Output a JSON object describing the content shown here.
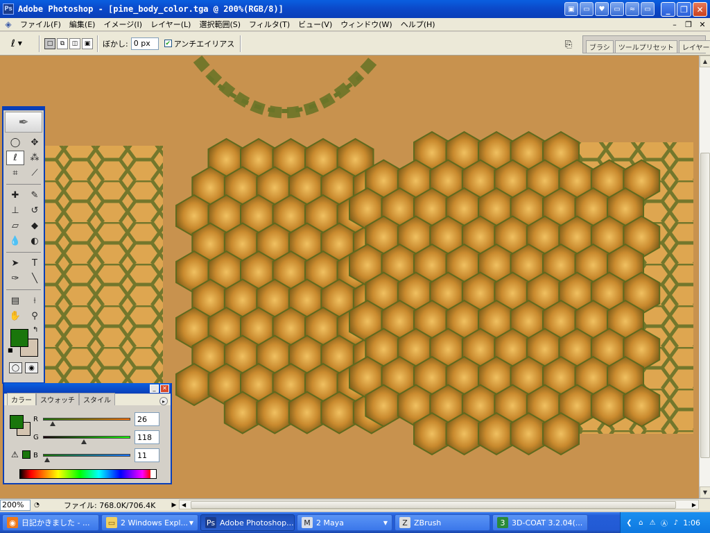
{
  "window": {
    "title": "Adobe Photoshop - [pine_body_color.tga @ 200%(RGB/8)]",
    "logo": "Ps"
  },
  "menu": [
    "ファイル(F)",
    "編集(E)",
    "イメージ(I)",
    "レイヤー(L)",
    "選択範囲(S)",
    "フィルタ(T)",
    "ビュー(V)",
    "ウィンドウ(W)",
    "ヘルプ(H)"
  ],
  "options": {
    "feather_label": "ぼかし:",
    "feather_value": "0 px",
    "antialias_label": "アンチエイリアス",
    "antialias_checked": true,
    "well_tabs": [
      "ブラシ",
      "ツールプリセット",
      "レイヤーカンプ"
    ]
  },
  "status": {
    "zoom": "200%",
    "file_size": "ファイル: 768.0K/706.4K"
  },
  "color_palette": {
    "tabs": [
      "カラー",
      "スウォッチ",
      "スタイル"
    ],
    "r_label": "R",
    "g_label": "G",
    "b_label": "B",
    "r": "26",
    "g": "118",
    "b": "11",
    "foreground": "#1a760b"
  },
  "taskbar": {
    "tasks": [
      {
        "label": "日記かきました - ...",
        "icon": "firefox-icon"
      },
      {
        "label": "2 Windows Expl...",
        "icon": "folder-icon"
      },
      {
        "label": "Adobe Photoshop...",
        "icon": "photoshop-icon"
      },
      {
        "label": "2 Maya",
        "icon": "maya-icon"
      },
      {
        "label": "ZBrush",
        "icon": "zbrush-icon"
      },
      {
        "label": "3D-COAT 3.2.04(...",
        "icon": "3dcoat-icon"
      }
    ],
    "clock": "1:06"
  },
  "colors": {
    "canvas_bg": "#c8924e",
    "scale_fill": "#c98a2e",
    "scale_outline": "#5f6a1e"
  }
}
